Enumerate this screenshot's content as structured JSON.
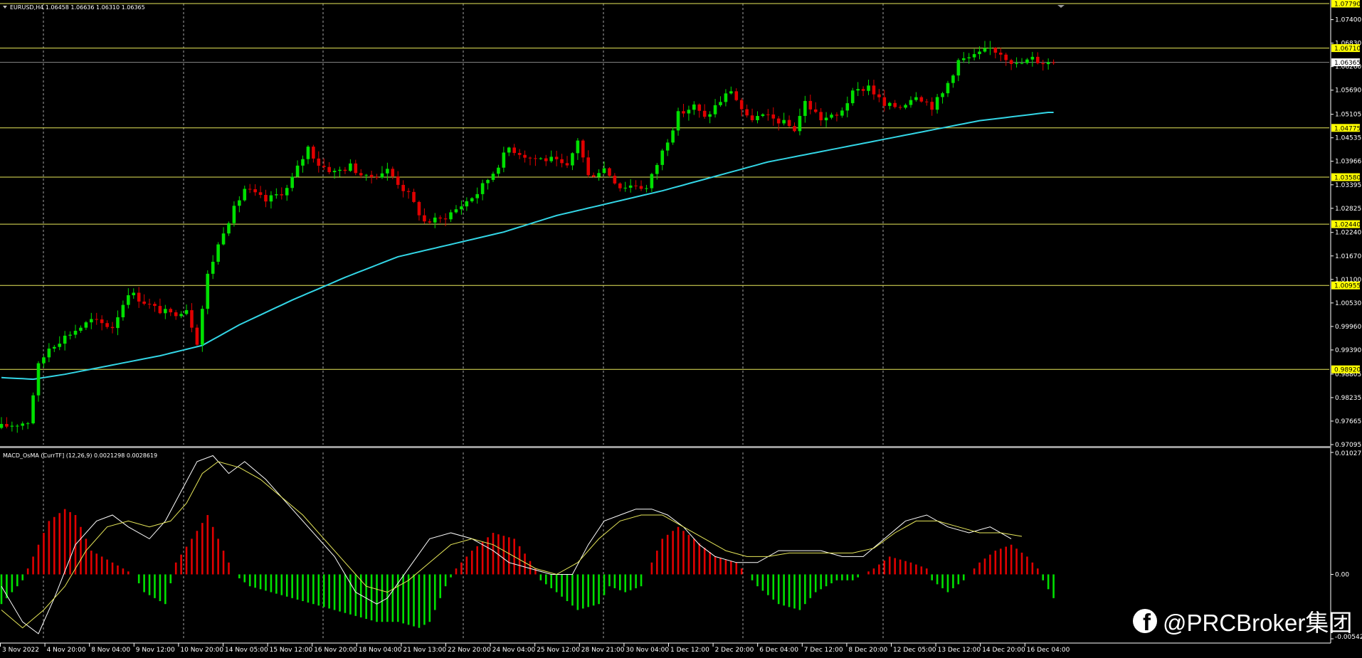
{
  "main_title": "EURUSD,H4  1.06458 1.06636 1.06310 1.06365",
  "indicator_title": "MACD_OsMA (CurrTF] (12,26,9) 0.0021298 0.0028619",
  "watermark": "@PRCBroker集团",
  "colors": {
    "background": "#000000",
    "bull": "#00e000",
    "bear": "#e00000",
    "ma": "#33d6e6",
    "hline": "#e8e85a",
    "grid": "#ffffff",
    "macd_line": "#ffffff",
    "signal_line": "#e8e85a",
    "price_label_bg": "#ffff00"
  },
  "icons": {
    "watermark": "facebook-icon",
    "title": "triangle-down-icon"
  },
  "chart_data": [
    {
      "type": "candlestick",
      "title": "EURUSD,H4",
      "ylim": [
        0.97095,
        1.0779
      ],
      "y_ticks": [
        1.074,
        1.0683,
        1.0626,
        1.0569,
        1.05105,
        1.04535,
        1.03966,
        1.03395,
        1.02825,
        1.0224,
        1.0167,
        1.011,
        1.0053,
        0.9996,
        0.9939,
        0.98805,
        0.98235,
        0.97665,
        0.97095
      ],
      "y_tick_labels": [
        "1.07400",
        "1.06830",
        "1.06260",
        "1.05690",
        "1.05105",
        "1.04535",
        "1.03966",
        "1.03395",
        "1.02825",
        "1.02240",
        "1.01670",
        "1.01100",
        "1.00530",
        "0.99960",
        "0.99390",
        "0.98805",
        "0.98235",
        "0.97665",
        "0.97095"
      ],
      "levels": [
        1.0779,
        1.0671,
        1.04775,
        1.0358,
        1.0244,
        1.00955,
        0.9892
      ],
      "level_labels": [
        "1.07790",
        "1.06710",
        "1.04775",
        "1.03580",
        "1.02440",
        "1.00955",
        "0.98920"
      ],
      "current_price": 1.06365,
      "current_price_label": "1.06365",
      "x_labels": [
        "3 Nov 2022",
        "4 Nov 20:00",
        "8 Nov 04:00",
        "9 Nov 12:00",
        "10 Nov 20:00",
        "14 Nov 05:00",
        "15 Nov 12:00",
        "16 Nov 20:00",
        "18 Nov 04:00",
        "21 Nov 13:00",
        "22 Nov 20:00",
        "24 Nov 04:00",
        "25 Nov 12:00",
        "28 Nov 21:00",
        "30 Nov 04:00",
        "1 Dec 12:00",
        "2 Dec 20:00",
        "6 Dec 04:00",
        "7 Dec 12:00",
        "8 Dec 20:00",
        "12 Dec 05:00",
        "13 Dec 12:00",
        "14 Dec 20:00",
        "16 Dec 04:00"
      ],
      "waypoints": [
        [
          0,
          0.975
        ],
        [
          6,
          0.9765
        ],
        [
          8,
          0.99
        ],
        [
          10,
          0.9945
        ],
        [
          14,
          0.998
        ],
        [
          18,
          1.001
        ],
        [
          22,
          0.9995
        ],
        [
          25,
          1.008
        ],
        [
          30,
          1.004
        ],
        [
          33,
          1.0025
        ],
        [
          36,
          1.004
        ],
        [
          38,
          0.996
        ],
        [
          40,
          1.012
        ],
        [
          43,
          1.023
        ],
        [
          47,
          1.033
        ],
        [
          51,
          1.03
        ],
        [
          55,
          1.033
        ],
        [
          59,
          1.043
        ],
        [
          61,
          1.039
        ],
        [
          64,
          1.037
        ],
        [
          67,
          1.0385
        ],
        [
          70,
          1.0355
        ],
        [
          74,
          1.0375
        ],
        [
          78,
          1.0315
        ],
        [
          81,
          1.025
        ],
        [
          84,
          1.0255
        ],
        [
          87,
          1.028
        ],
        [
          91,
          1.032
        ],
        [
          94,
          1.037
        ],
        [
          97,
          1.043
        ],
        [
          101,
          1.0405
        ],
        [
          105,
          1.04
        ],
        [
          108,
          1.038
        ],
        [
          110,
          1.045
        ],
        [
          112,
          1.036
        ],
        [
          115,
          1.038
        ],
        [
          118,
          1.0335
        ],
        [
          121,
          1.034
        ],
        [
          123,
          1.033
        ],
        [
          126,
          1.042
        ],
        [
          129,
          1.051
        ],
        [
          132,
          1.053
        ],
        [
          134,
          1.05
        ],
        [
          136,
          1.053
        ],
        [
          139,
          1.057
        ],
        [
          142,
          1.05
        ],
        [
          145,
          1.0505
        ],
        [
          148,
          1.0495
        ],
        [
          151,
          1.0475
        ],
        [
          153,
          1.054
        ],
        [
          156,
          1.05
        ],
        [
          159,
          1.0505
        ],
        [
          162,
          1.056
        ],
        [
          165,
          1.058
        ],
        [
          168,
          1.053
        ],
        [
          171,
          1.053
        ],
        [
          174,
          1.056
        ],
        [
          177,
          1.053
        ],
        [
          179,
          1.056
        ],
        [
          182,
          1.064
        ],
        [
          185,
          1.065
        ],
        [
          188,
          1.067
        ],
        [
          190,
          1.066
        ],
        [
          193,
          1.063
        ],
        [
          196,
          1.0645
        ],
        [
          198,
          1.06365
        ]
      ],
      "ma_points": [
        [
          0,
          0.9872
        ],
        [
          6,
          0.9868
        ],
        [
          12,
          0.988
        ],
        [
          20,
          0.99
        ],
        [
          30,
          0.9925
        ],
        [
          38,
          0.995
        ],
        [
          45,
          1.0
        ],
        [
          55,
          1.006
        ],
        [
          65,
          1.0115
        ],
        [
          75,
          1.0165
        ],
        [
          85,
          1.0195
        ],
        [
          95,
          1.0225
        ],
        [
          105,
          1.0265
        ],
        [
          115,
          1.0295
        ],
        [
          125,
          1.0325
        ],
        [
          135,
          1.036
        ],
        [
          145,
          1.0395
        ],
        [
          155,
          1.042
        ],
        [
          165,
          1.0445
        ],
        [
          175,
          1.047
        ],
        [
          185,
          1.0495
        ],
        [
          198,
          1.0515
        ]
      ]
    },
    {
      "type": "histogram",
      "title": "MACD_OsMA",
      "ylim": [
        -0.005424,
        0.0102723
      ],
      "y_ticks": [
        0.0102723,
        0.0,
        -0.005424
      ],
      "y_tick_labels": [
        "0.0102723",
        "0.00",
        "-0.005424"
      ],
      "hist_waypoints": [
        [
          0,
          -0.0025
        ],
        [
          4,
          -0.0005
        ],
        [
          6,
          0.0015
        ],
        [
          9,
          0.0045
        ],
        [
          12,
          0.0055
        ],
        [
          14,
          0.005
        ],
        [
          17,
          0.002
        ],
        [
          21,
          0.001
        ],
        [
          25,
          0.0
        ],
        [
          27,
          -0.0015
        ],
        [
          31,
          -0.0025
        ],
        [
          33,
          0.001
        ],
        [
          36,
          0.003
        ],
        [
          39,
          0.005
        ],
        [
          41,
          0.003
        ],
        [
          44,
          0.0
        ],
        [
          47,
          -0.001
        ],
        [
          51,
          -0.0015
        ],
        [
          55,
          -0.002
        ],
        [
          59,
          -0.0025
        ],
        [
          63,
          -0.003
        ],
        [
          67,
          -0.0035
        ],
        [
          71,
          -0.004
        ],
        [
          75,
          -0.004
        ],
        [
          79,
          -0.0045
        ],
        [
          81,
          -0.004
        ],
        [
          84,
          -0.001
        ],
        [
          86,
          0.0005
        ],
        [
          89,
          0.002
        ],
        [
          93,
          0.0035
        ],
        [
          97,
          0.003
        ],
        [
          101,
          0.0005
        ],
        [
          102,
          -0.0005
        ],
        [
          105,
          -0.0015
        ],
        [
          109,
          -0.003
        ],
        [
          113,
          -0.0025
        ],
        [
          115,
          -0.001
        ],
        [
          118,
          -0.0015
        ],
        [
          121,
          -0.001
        ],
        [
          123,
          0.001
        ],
        [
          125,
          0.003
        ],
        [
          128,
          0.004
        ],
        [
          131,
          0.003
        ],
        [
          135,
          0.0015
        ],
        [
          139,
          0.001
        ],
        [
          141,
          0.0
        ],
        [
          143,
          -0.001
        ],
        [
          147,
          -0.0025
        ],
        [
          151,
          -0.003
        ],
        [
          154,
          -0.0015
        ],
        [
          158,
          -0.0005
        ],
        [
          161,
          -0.0005
        ],
        [
          165,
          0.0005
        ],
        [
          168,
          0.0015
        ],
        [
          172,
          0.001
        ],
        [
          175,
          0.0005
        ],
        [
          176,
          -0.0005
        ],
        [
          179,
          -0.0015
        ],
        [
          182,
          -0.0005
        ],
        [
          185,
          0.001
        ],
        [
          188,
          0.002
        ],
        [
          191,
          0.0025
        ],
        [
          194,
          0.0015
        ],
        [
          196,
          0.0005
        ],
        [
          197,
          -0.0005
        ],
        [
          199,
          -0.002
        ]
      ],
      "macd_points": [
        [
          0,
          -0.001
        ],
        [
          4,
          -0.004
        ],
        [
          7,
          -0.005
        ],
        [
          10,
          -0.002
        ],
        [
          14,
          0.0025
        ],
        [
          18,
          0.0045
        ],
        [
          21,
          0.005
        ],
        [
          24,
          0.004
        ],
        [
          28,
          0.003
        ],
        [
          31,
          0.0045
        ],
        [
          34,
          0.007
        ],
        [
          37,
          0.0095
        ],
        [
          40,
          0.01
        ],
        [
          43,
          0.0085
        ],
        [
          46,
          0.0095
        ],
        [
          50,
          0.008
        ],
        [
          54,
          0.006
        ],
        [
          58,
          0.004
        ],
        [
          63,
          0.0015
        ],
        [
          67,
          -0.0015
        ],
        [
          71,
          -0.0025
        ],
        [
          73,
          -0.002
        ],
        [
          77,
          0.0005
        ],
        [
          81,
          0.003
        ],
        [
          85,
          0.0035
        ],
        [
          89,
          0.003
        ],
        [
          93,
          0.002
        ],
        [
          96,
          0.001
        ],
        [
          100,
          0.0005
        ],
        [
          104,
          0.0
        ],
        [
          108,
          0.0
        ],
        [
          111,
          0.0025
        ],
        [
          114,
          0.0045
        ],
        [
          117,
          0.005
        ],
        [
          120,
          0.0055
        ],
        [
          123,
          0.0055
        ],
        [
          126,
          0.005
        ],
        [
          129,
          0.004
        ],
        [
          132,
          0.0025
        ],
        [
          135,
          0.0015
        ],
        [
          139,
          0.001
        ],
        [
          143,
          0.001
        ],
        [
          147,
          0.002
        ],
        [
          151,
          0.002
        ],
        [
          155,
          0.002
        ],
        [
          159,
          0.0015
        ],
        [
          163,
          0.0015
        ],
        [
          167,
          0.003
        ],
        [
          171,
          0.0045
        ],
        [
          175,
          0.005
        ],
        [
          179,
          0.004
        ],
        [
          183,
          0.0035
        ],
        [
          187,
          0.004
        ],
        [
          191,
          0.003
        ]
      ],
      "signal_points": [
        [
          0,
          -0.003
        ],
        [
          4,
          -0.0045
        ],
        [
          8,
          -0.003
        ],
        [
          12,
          -0.001
        ],
        [
          16,
          0.002
        ],
        [
          20,
          0.004
        ],
        [
          24,
          0.0045
        ],
        [
          28,
          0.004
        ],
        [
          32,
          0.0045
        ],
        [
          35,
          0.006
        ],
        [
          38,
          0.0085
        ],
        [
          41,
          0.0095
        ],
        [
          45,
          0.009
        ],
        [
          49,
          0.008
        ],
        [
          53,
          0.0065
        ],
        [
          57,
          0.005
        ],
        [
          61,
          0.003
        ],
        [
          65,
          0.001
        ],
        [
          69,
          -0.001
        ],
        [
          73,
          -0.0015
        ],
        [
          77,
          -0.0005
        ],
        [
          81,
          0.001
        ],
        [
          85,
          0.0025
        ],
        [
          89,
          0.003
        ],
        [
          93,
          0.0025
        ],
        [
          97,
          0.0015
        ],
        [
          101,
          0.0005
        ],
        [
          105,
          0.0
        ],
        [
          109,
          0.001
        ],
        [
          113,
          0.003
        ],
        [
          117,
          0.0045
        ],
        [
          121,
          0.005
        ],
        [
          125,
          0.005
        ],
        [
          129,
          0.004
        ],
        [
          133,
          0.003
        ],
        [
          137,
          0.002
        ],
        [
          141,
          0.0015
        ],
        [
          145,
          0.0015
        ],
        [
          149,
          0.0018
        ],
        [
          153,
          0.0018
        ],
        [
          157,
          0.0018
        ],
        [
          161,
          0.0018
        ],
        [
          165,
          0.0022
        ],
        [
          169,
          0.0035
        ],
        [
          173,
          0.0045
        ],
        [
          177,
          0.0045
        ],
        [
          181,
          0.004
        ],
        [
          185,
          0.0035
        ],
        [
          189,
          0.0035
        ],
        [
          193,
          0.0032
        ]
      ]
    }
  ]
}
